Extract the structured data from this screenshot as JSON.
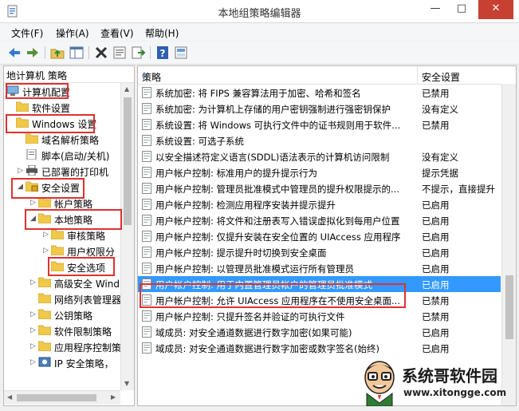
{
  "window": {
    "title": "本地组策略编辑器",
    "controls": {
      "minimize": "—",
      "maximize": "□",
      "close": "✕"
    }
  },
  "menu": [
    "文件(F)",
    "操作(A)",
    "查看(V)",
    "帮助(H)"
  ],
  "toolbar": {
    "icons": [
      "back-icon",
      "forward-icon",
      "up-folder-icon",
      "show-hide-tree-icon",
      "delete-icon",
      "properties-icon",
      "export-icon",
      "help-icon",
      "view-icon"
    ]
  },
  "tree": {
    "header": "地计算机 策略",
    "items": [
      {
        "label": "计算机配置",
        "level": 0,
        "arrow": "",
        "icon": "computer"
      },
      {
        "label": "软件设置",
        "level": 1,
        "arrow": "",
        "icon": "folder"
      },
      {
        "label": "Windows 设置",
        "level": 1,
        "arrow": "",
        "icon": "folder"
      },
      {
        "label": "域名解析策略",
        "level": 2,
        "arrow": "",
        "icon": "folder"
      },
      {
        "label": "脚本(启动/关机)",
        "level": 2,
        "arrow": "",
        "icon": "script"
      },
      {
        "label": "已部署的打印机",
        "level": 2,
        "arrow": "▷",
        "icon": "printer"
      },
      {
        "label": "安全设置",
        "level": 2,
        "arrow": "◢",
        "icon": "security"
      },
      {
        "label": "帐户策略",
        "level": 3,
        "arrow": "▷",
        "icon": "folder"
      },
      {
        "label": "本地策略",
        "level": 3,
        "arrow": "◢",
        "icon": "folder"
      },
      {
        "label": "审核策略",
        "level": 4,
        "arrow": "▷",
        "icon": "folder"
      },
      {
        "label": "用户权限分",
        "level": 4,
        "arrow": "▷",
        "icon": "folder"
      },
      {
        "label": "安全选项",
        "level": 4,
        "arrow": "",
        "icon": "folder"
      },
      {
        "label": "高级安全 Wind",
        "level": 3,
        "arrow": "▷",
        "icon": "folder"
      },
      {
        "label": "网络列表管理器",
        "level": 3,
        "arrow": "",
        "icon": "folder"
      },
      {
        "label": "公钥策略",
        "level": 3,
        "arrow": "▷",
        "icon": "folder"
      },
      {
        "label": "软件限制策略",
        "level": 3,
        "arrow": "▷",
        "icon": "folder"
      },
      {
        "label": "应用程序控制策",
        "level": 3,
        "arrow": "▷",
        "icon": "folder"
      },
      {
        "label": "IP 安全策略，",
        "level": 3,
        "arrow": "▷",
        "icon": "ipsec"
      }
    ]
  },
  "list": {
    "col_policy": "策略",
    "col_setting": "安全设置",
    "rows": [
      {
        "policy": "系统加密: 将 FIPS 兼容算法用于加密、哈希和签名",
        "setting": "已禁用"
      },
      {
        "policy": "系统加密: 为计算机上存储的用户密钥强制进行强密钥保护",
        "setting": "没有定义"
      },
      {
        "policy": "系统设置: 将 Windows 可执行文件中的证书规则用于软件...",
        "setting": "已禁用"
      },
      {
        "policy": "系统设置: 可选子系统",
        "setting": ""
      },
      {
        "policy": "以安全描述符定义语言(SDDL)语法表示的计算机访问限制",
        "setting": "没有定义"
      },
      {
        "policy": "用户帐户控制: 标准用户的提升提示行为",
        "setting": "提示凭据"
      },
      {
        "policy": "用户帐户控制: 管理员批准模式中管理员的提升权限提示的...",
        "setting": "不提示，直接提升"
      },
      {
        "policy": "用户帐户控制: 检测应用程序安装并提示提升",
        "setting": "已启用"
      },
      {
        "policy": "用户帐户控制: 将文件和注册表写入错误虚拟化到每用户位置",
        "setting": "已启用"
      },
      {
        "policy": "用户帐户控制: 仅提升安装在安全位置的 UIAccess 应用程序",
        "setting": "已启用"
      },
      {
        "policy": "用户帐户控制: 提示提升时切换到安全桌面",
        "setting": "已启用"
      },
      {
        "policy": "用户帐户控制: 以管理员批准模式运行所有管理员",
        "setting": "已启用"
      },
      {
        "policy": "用户帐户控制: 用于内置管理员帐户的管理员批准模式",
        "setting": "已启用"
      },
      {
        "policy": "用户帐户控制: 允许 UIAccess 应用程序在不使用安全桌面...",
        "setting": "已禁用"
      },
      {
        "policy": "用户帐户控制: 只提升签名并验证的可执行文件",
        "setting": "已禁用"
      },
      {
        "policy": "域成员: 对安全通道数据进行数字加密(如果可能)",
        "setting": "已启用"
      },
      {
        "policy": "域成员: 对安全通道数据进行数字加密或数字签名(始终)",
        "setting": "已启用"
      }
    ],
    "selected_index": 12
  },
  "watermark": {
    "name": "系统哥软件园",
    "url": "www.xitongge.com"
  },
  "colors": {
    "selection": "#3399ff",
    "highlight_box": "#e03030",
    "close_button": "#c84031"
  }
}
